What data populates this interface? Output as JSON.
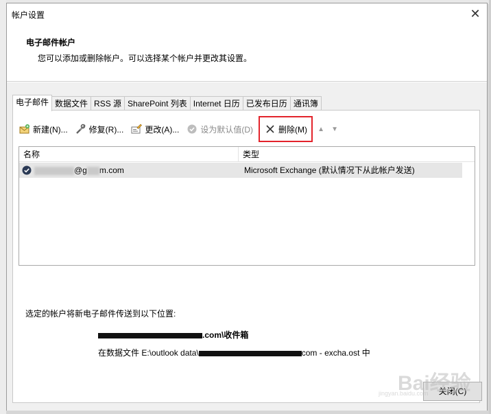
{
  "window": {
    "title": "帐户设置"
  },
  "header": {
    "title": "电子邮件帐户",
    "description": "您可以添加或删除帐户。可以选择某个帐户并更改其设置。"
  },
  "tabs": [
    {
      "label": "电子邮件",
      "active": true
    },
    {
      "label": "数据文件"
    },
    {
      "label": "RSS 源"
    },
    {
      "label": "SharePoint 列表"
    },
    {
      "label": "Internet 日历"
    },
    {
      "label": "已发布日历"
    },
    {
      "label": "通讯簿"
    }
  ],
  "toolbar": {
    "new_label": "新建(N)...",
    "repair_label": "修复(R)...",
    "change_label": "更改(A)...",
    "set_default_label": "设为默认值(D)",
    "remove_label": "删除(M)",
    "highlight_color": "#e3232b"
  },
  "list": {
    "columns": [
      "名称",
      "类型"
    ],
    "rows": [
      {
        "name_suffix": "@g",
        "name_end": "m.com",
        "type": "Microsoft Exchange (默认情况下从此帐户发送)"
      }
    ]
  },
  "delivery": {
    "label": "选定的帐户将新电子邮件传送到以下位置:",
    "target_suffix": ".com\\收件箱",
    "file_prefix": "在数据文件 E:\\outlook data\\",
    "file_suffix": "com - excha.ost 中"
  },
  "buttons": {
    "close_label": "关闭(C)"
  },
  "watermark": {
    "text": "Bai经验",
    "sub": "jingyan.baidu.com"
  }
}
